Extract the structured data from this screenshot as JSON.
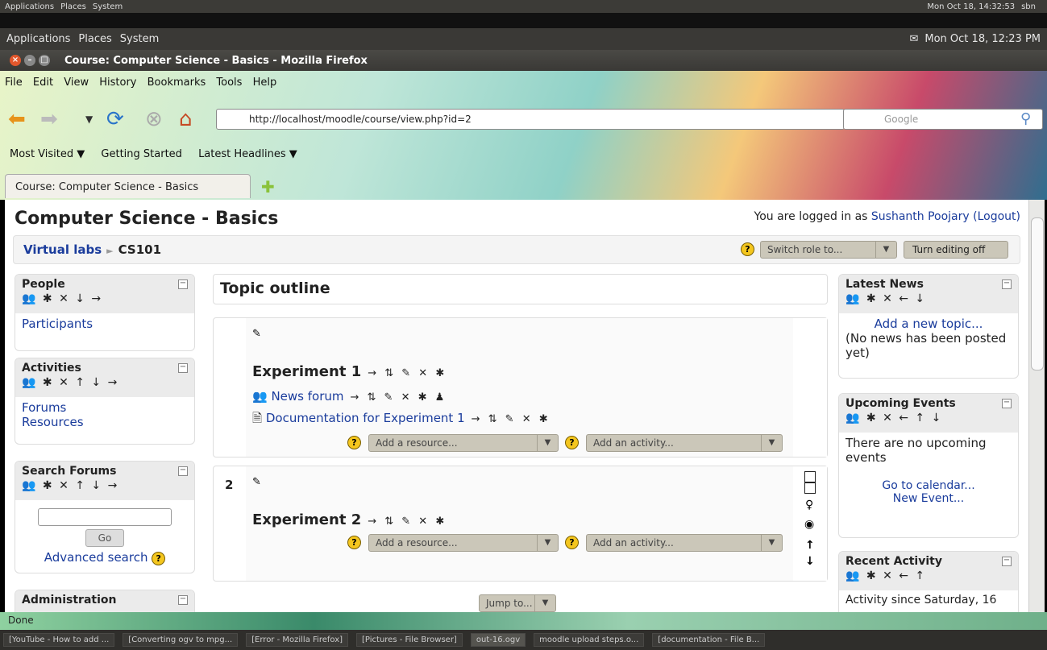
{
  "outer_panel": {
    "menus": [
      "Applications",
      "Places",
      "System"
    ],
    "clock": "Mon Oct 18, 14:32:53",
    "user": "sbn"
  },
  "inner_panel": {
    "menus": [
      "Applications",
      "Places",
      "System"
    ],
    "clock": "Mon Oct 18, 12:23 PM"
  },
  "window": {
    "title": "Course: Computer Science - Basics - Mozilla Firefox"
  },
  "menubar": [
    "File",
    "Edit",
    "View",
    "History",
    "Bookmarks",
    "Tools",
    "Help"
  ],
  "urlbar": {
    "url": "http://localhost/moodle/course/view.php?id=2"
  },
  "search": {
    "placeholder": "Google"
  },
  "bookmarks": [
    "Most Visited ▼",
    "Getting Started",
    "Latest Headlines ▼"
  ],
  "tab": {
    "label": "Course: Computer Science - Basics"
  },
  "page": {
    "title": "Computer Science - Basics",
    "login_prefix": "You are logged in as",
    "login_user": "Sushanth Poojary",
    "logout": "(Logout)",
    "breadcrumb": {
      "root": "Virtual labs",
      "sep": "►",
      "current": "CS101"
    },
    "switch_role": "Switch role to...",
    "turn_editing": "Turn editing off"
  },
  "left_blocks": {
    "people": {
      "title": "People",
      "icons": "👥 ✱ ✕ ↓ →",
      "items": [
        "Participants"
      ]
    },
    "activities": {
      "title": "Activities",
      "icons": "👥 ✱ ✕ ↑ ↓ →",
      "items": [
        "Forums",
        "Resources"
      ]
    },
    "search": {
      "title": "Search Forums",
      "icons": "👥 ✱ ✕ ↑ ↓ →",
      "go": "Go",
      "advanced": "Advanced search"
    },
    "admin": {
      "title": "Administration"
    }
  },
  "center": {
    "outline_title": "Topic outline",
    "section1": {
      "title": "Experiment 1",
      "icons": "→ ⇅ ✎ ✕ ✱",
      "modules": [
        {
          "label": "News forum",
          "icons": "→ ⇅ ✎ ✕ ✱ ♟"
        },
        {
          "label": "Documentation for Experiment 1",
          "icons": "→ ⇅ ✎ ✕ ✱"
        }
      ],
      "add_resource": "Add a resource...",
      "add_activity": "Add an activity..."
    },
    "section2": {
      "number": "2",
      "title": "Experiment 2",
      "icons": "→ ⇅ ✎ ✕ ✱",
      "add_resource": "Add a resource...",
      "add_activity": "Add an activity..."
    },
    "jump": "Jump to..."
  },
  "right_blocks": {
    "news": {
      "title": "Latest News",
      "icons": "👥 ✱ ✕ ← ↓",
      "add": "Add a new topic...",
      "empty": "(No news has been posted yet)"
    },
    "events": {
      "title": "Upcoming Events",
      "icons": "👥 ✱ ✕ ← ↑ ↓",
      "text": "There are no upcoming events",
      "calendar": "Go to calendar...",
      "new_event": "New Event..."
    },
    "recent": {
      "title": "Recent Activity",
      "icons": "👥 ✱ ✕ ← ↑",
      "since": "Activity since Saturday, 16"
    }
  },
  "status": "Done",
  "taskbar": [
    "[YouTube - How to add ...",
    "[Converting ogv to mpg...",
    "[Error - Mozilla Firefox]",
    "[Pictures - File Browser]",
    "out-16.ogv",
    "moodle upload steps.o...",
    "[documentation - File B..."
  ]
}
